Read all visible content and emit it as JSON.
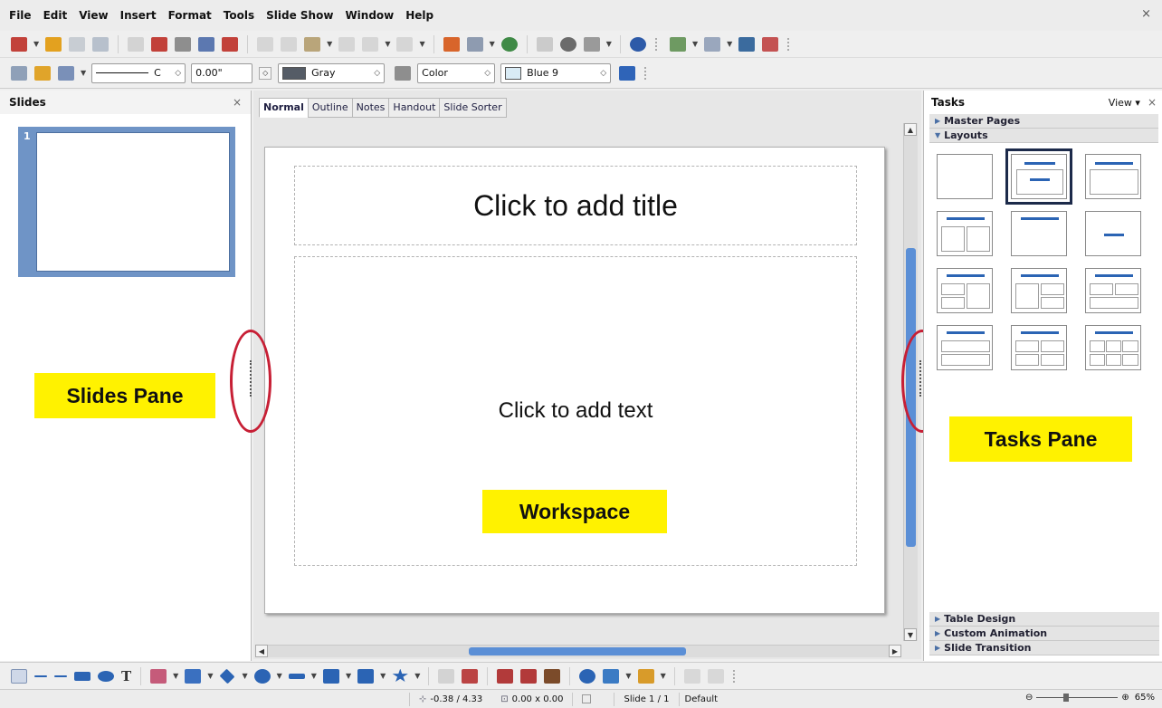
{
  "menubar": {
    "items": [
      "File",
      "Edit",
      "View",
      "Insert",
      "Format",
      "Tools",
      "Slide Show",
      "Window",
      "Help"
    ],
    "close": "×"
  },
  "format_toolbar": {
    "line_style": "C",
    "line_width": "0.00\"",
    "line_color": "Gray",
    "area_style": "Color",
    "area_color": "Blue 9"
  },
  "slides_pane": {
    "title": "Slides",
    "close": "×",
    "thumbnail_number": "1"
  },
  "workspace": {
    "tabs": [
      "Normal",
      "Outline",
      "Notes",
      "Handout",
      "Slide Sorter"
    ],
    "active_tab": "Normal",
    "title_placeholder": "Click to add title",
    "text_placeholder": "Click to add text"
  },
  "tasks_pane": {
    "title": "Tasks",
    "view_menu": "View",
    "close": "×",
    "sections_top": [
      "Master Pages",
      "Layouts"
    ],
    "sections_bottom": [
      "Table Design",
      "Custom Animation",
      "Slide Transition"
    ],
    "selected_layout_index": 1
  },
  "annotations": {
    "slides_pane": "Slides Pane",
    "workspace": "Workspace",
    "tasks_pane": "Tasks Pane"
  },
  "statusbar": {
    "position": "-0.38 / 4.33",
    "size": "0.00 x 0.00",
    "slide": "Slide 1 / 1",
    "master": "Default",
    "zoom": "65%"
  },
  "colors": {
    "highlight_yellow": "#fff200",
    "ring_red": "#c71f35",
    "accent_blue": "#5b8fd6",
    "thumb_blue": "#6f94c6"
  }
}
